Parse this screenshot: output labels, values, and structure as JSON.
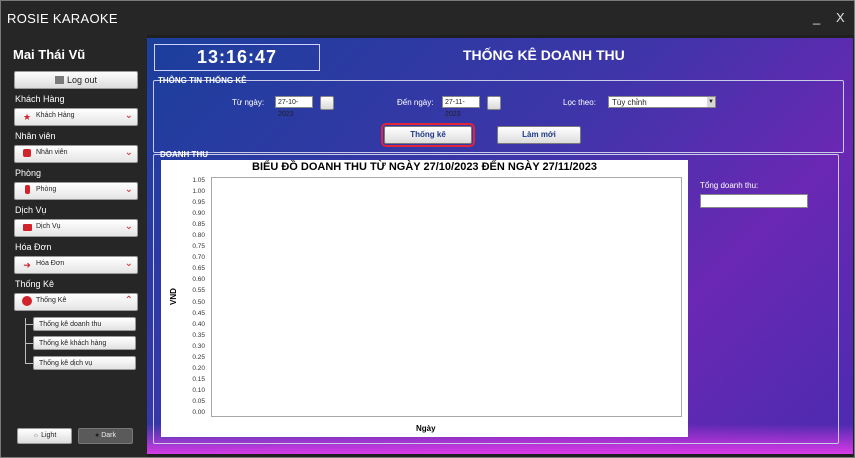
{
  "window": {
    "title": "ROSIE KARAOKE",
    "minimize": "_",
    "close": "X"
  },
  "sidebar": {
    "user": "Mai Thái Vũ",
    "logout": "Log out",
    "sections": [
      {
        "title": "Khách Hàng",
        "item": "Khách Hàng",
        "icon": "person-icon",
        "color": "#d2232a"
      },
      {
        "title": "Nhân viên",
        "item": "Nhân viên",
        "icon": "employee-icon",
        "color": "#d2232a"
      },
      {
        "title": "Phòng",
        "item": "Phòng",
        "icon": "room-icon",
        "color": "#d2232a"
      },
      {
        "title": "Dịch Vụ",
        "item": "Dịch Vụ",
        "icon": "service-icon",
        "color": "#d2232a"
      },
      {
        "title": "Hóa Đơn",
        "item": "Hóa Đơn",
        "icon": "invoice-icon",
        "color": "#d2232a"
      },
      {
        "title": "Thống Kê",
        "item": "Thống Kê",
        "icon": "pie-chart-icon",
        "color": "#d2232a"
      }
    ],
    "statistics_items": [
      "Thống kê doanh thu",
      "Thống kê khách hàng",
      "Thống kê dịch vụ"
    ],
    "theme_light": "Light",
    "theme_dark": "Dark"
  },
  "main": {
    "clock": "13:16:47",
    "heading": "THỐNG KÊ DOANH THU",
    "filter_group": "THÔNG TIN THỐNG KÊ",
    "from_label": "Từ ngày:",
    "from_value": "27-10-2023",
    "to_label": "Đến ngày:",
    "to_value": "27-11-2023",
    "filter_label": "Lọc theo:",
    "filter_value": "Tùy chỉnh",
    "stats_button": "Thống kê",
    "reset_button": "Làm mới",
    "revenue_group": "DOANH THU",
    "total_label": "Tổng doanh thu:",
    "total_value": ""
  },
  "chart_data": {
    "type": "line",
    "title": "BIỂU ĐỒ DOANH THU TỪ NGÀY 27/10/2023 ĐẾN NGÀY 27/11/2023",
    "xlabel": "Ngày",
    "ylabel": "VND",
    "ylim": [
      0,
      1.05
    ],
    "yticks": [
      "1.05",
      "1.00",
      "0.95",
      "0.90",
      "0.85",
      "0.80",
      "0.75",
      "0.70",
      "0.65",
      "0.60",
      "0.55",
      "0.50",
      "0.45",
      "0.40",
      "0.35",
      "0.30",
      "0.25",
      "0.20",
      "0.15",
      "0.10",
      "0.05",
      "0.00"
    ],
    "series": [],
    "grid": false
  }
}
